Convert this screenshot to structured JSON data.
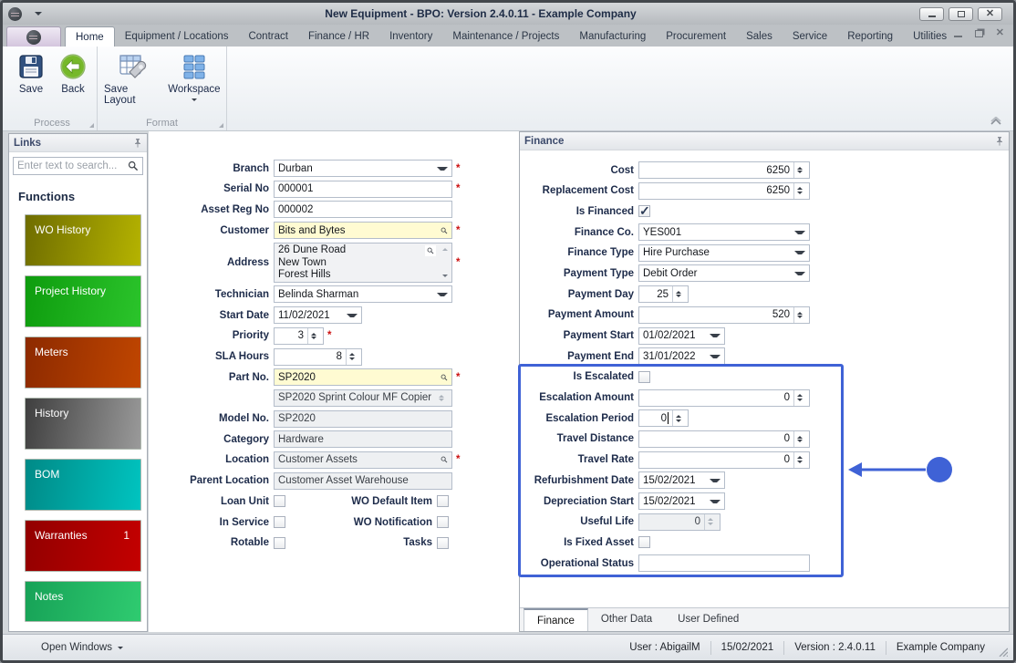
{
  "window": {
    "title": "New Equipment - BPO: Version 2.4.0.11 - Example Company"
  },
  "ribbon": {
    "tabs": [
      {
        "label": "Home",
        "active": true
      },
      {
        "label": "Equipment / Locations"
      },
      {
        "label": "Contract"
      },
      {
        "label": "Finance / HR"
      },
      {
        "label": "Inventory"
      },
      {
        "label": "Maintenance / Projects"
      },
      {
        "label": "Manufacturing"
      },
      {
        "label": "Procurement"
      },
      {
        "label": "Sales"
      },
      {
        "label": "Service"
      },
      {
        "label": "Reporting"
      },
      {
        "label": "Utilities"
      }
    ],
    "save_label": "Save",
    "back_label": "Back",
    "save_layout_label": "Save Layout",
    "workspace_label": "Workspace",
    "group_process": "Process",
    "group_format": "Format"
  },
  "links_panel": {
    "title": "Links",
    "search_placeholder": "Enter text to search...",
    "section_title": "Functions",
    "buttons": [
      {
        "label": "WO History",
        "color_from": "#6f6d00",
        "color_to": "#b5b300"
      },
      {
        "label": "Project History",
        "color_from": "#0e9c0e",
        "color_to": "#2bc42b"
      },
      {
        "label": "Meters",
        "color_from": "#8d2a00",
        "color_to": "#c04600"
      },
      {
        "label": "History",
        "color_from": "#3f3f3f",
        "color_to": "#9a9a9a"
      },
      {
        "label": "BOM",
        "color_from": "#008a87",
        "color_to": "#00c4c0"
      },
      {
        "label": "Warranties",
        "badge": "1",
        "color_from": "#920000",
        "color_to": "#c40000"
      },
      {
        "label": "Notes",
        "color_from": "#17a257",
        "color_to": "#2fcb70"
      }
    ]
  },
  "form": {
    "branch": {
      "label": "Branch",
      "value": "Durban",
      "required": "*"
    },
    "serial_no": {
      "label": "Serial No",
      "value": "000001",
      "required": "*"
    },
    "asset_reg_no": {
      "label": "Asset Reg No",
      "value": "000002"
    },
    "customer": {
      "label": "Customer",
      "value": "Bits and Bytes",
      "required": "*"
    },
    "address": {
      "label": "Address",
      "line1": "26 Dune Road",
      "line2": "New Town",
      "line3": "Forest Hills",
      "required": "*"
    },
    "technician": {
      "label": "Technician",
      "value": "Belinda Sharman"
    },
    "start_date": {
      "label": "Start Date",
      "value": "11/02/2021"
    },
    "priority": {
      "label": "Priority",
      "value": "3",
      "required": "*"
    },
    "sla_hours": {
      "label": "SLA Hours",
      "value": "8"
    },
    "part_no": {
      "label": "Part No.",
      "value": "SP2020",
      "required": "*"
    },
    "part_description": {
      "value": "SP2020 Sprint Colour MF Copier"
    },
    "model_no": {
      "label": "Model No.",
      "value": "SP2020"
    },
    "category": {
      "label": "Category",
      "value": "Hardware"
    },
    "location": {
      "label": "Location",
      "value": "Customer Assets",
      "required": "*"
    },
    "parent_location": {
      "label": "Parent Location",
      "value": "Customer Asset Warehouse"
    },
    "checkboxes": {
      "loan_unit": "Loan Unit",
      "wo_default_item": "WO Default Item",
      "in_service": "In Service",
      "wo_notification": "WO Notification",
      "rotable": "Rotable",
      "tasks": "Tasks"
    }
  },
  "finance": {
    "panel_title": "Finance",
    "cost": {
      "label": "Cost",
      "value": "6250"
    },
    "replacement_cost": {
      "label": "Replacement Cost",
      "value": "6250"
    },
    "is_financed": {
      "label": "Is Financed",
      "checked": true
    },
    "finance_co": {
      "label": "Finance Co.",
      "value": "YES001"
    },
    "finance_type": {
      "label": "Finance Type",
      "value": "Hire Purchase"
    },
    "payment_type": {
      "label": "Payment Type",
      "value": "Debit Order"
    },
    "payment_day": {
      "label": "Payment Day",
      "value": "25"
    },
    "payment_amount": {
      "label": "Payment Amount",
      "value": "520"
    },
    "payment_start": {
      "label": "Payment Start",
      "value": "01/02/2021"
    },
    "payment_end": {
      "label": "Payment End",
      "value": "31/01/2022"
    },
    "is_escalated": {
      "label": "Is Escalated",
      "checked": false
    },
    "escalation_amount": {
      "label": "Escalation Amount",
      "value": "0"
    },
    "escalation_period": {
      "label": "Escalation Period",
      "value": "0"
    },
    "travel_distance": {
      "label": "Travel Distance",
      "value": "0"
    },
    "travel_rate": {
      "label": "Travel Rate",
      "value": "0"
    },
    "refurbishment_date": {
      "label": "Refurbishment Date",
      "value": "15/02/2021"
    },
    "depreciation_start": {
      "label": "Depreciation Start",
      "value": "15/02/2021"
    },
    "useful_life": {
      "label": "Useful Life",
      "value": "0"
    },
    "is_fixed_asset": {
      "label": "Is Fixed Asset",
      "checked": false
    },
    "operational_status": {
      "label": "Operational Status",
      "value": ""
    }
  },
  "bottom_tabs": [
    {
      "label": "Finance",
      "active": true
    },
    {
      "label": "Other Data"
    },
    {
      "label": "User Defined"
    }
  ],
  "status_bar": {
    "open_windows": "Open Windows",
    "user": "User : AbigailM",
    "date": "15/02/2021",
    "version": "Version : 2.4.0.11",
    "company": "Example Company"
  },
  "annotation": {
    "color": "#3f62d6"
  }
}
